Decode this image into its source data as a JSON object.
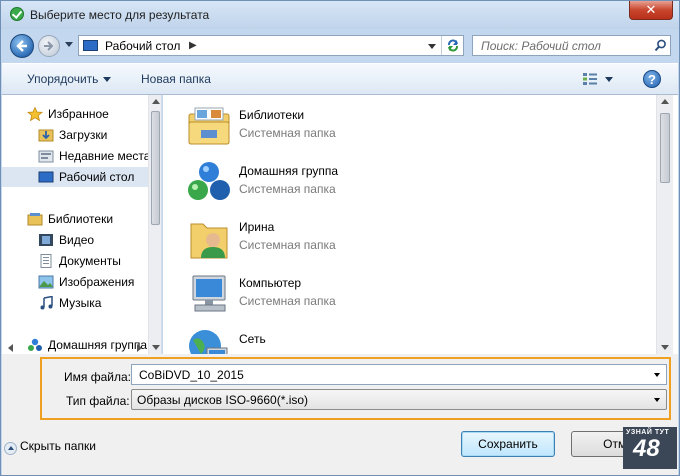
{
  "window": {
    "title": "Выберите место для результата"
  },
  "navbar": {
    "address": "Рабочий стол",
    "search_placeholder": "Поиск: Рабочий стол"
  },
  "toolbar": {
    "organize_label": "Упорядочить",
    "new_folder_label": "Новая папка",
    "help_label": "?"
  },
  "navpane": {
    "items": [
      {
        "label": "Избранное",
        "icon": "star-icon"
      },
      {
        "label": "Загрузки",
        "icon": "downloads-folder-icon"
      },
      {
        "label": "Недавние места",
        "icon": "recent-places-icon"
      },
      {
        "label": "Рабочий стол",
        "icon": "desktop-icon",
        "selected": true
      },
      {
        "label": "Библиотеки",
        "icon": "libraries-icon"
      },
      {
        "label": "Видео",
        "icon": "video-icon"
      },
      {
        "label": "Документы",
        "icon": "documents-icon"
      },
      {
        "label": "Изображения",
        "icon": "pictures-icon"
      },
      {
        "label": "Музыка",
        "icon": "music-icon"
      },
      {
        "label": "Домашняя группа",
        "icon": "homegroup-icon"
      }
    ]
  },
  "files": [
    {
      "name": "Библиотеки",
      "type": "Системная папка",
      "icon": "libraries-folder-icon"
    },
    {
      "name": "Домашняя группа",
      "type": "Системная папка",
      "icon": "homegroup-icon"
    },
    {
      "name": "Ирина",
      "type": "Системная папка",
      "icon": "user-folder-icon"
    },
    {
      "name": "Компьютер",
      "type": "Системная папка",
      "icon": "computer-icon"
    },
    {
      "name": "Сеть",
      "type": "",
      "icon": "network-icon"
    }
  ],
  "form": {
    "filename_label": "Имя файла:",
    "filename_value": "CoBiDVD_10_2015",
    "filetype_label": "Тип файла:",
    "filetype_value": "Образы дисков ISO-9660(*.iso)"
  },
  "footer": {
    "hide_folders_label": "Скрыть папки",
    "save_label": "Сохранить",
    "cancel_label": "Отме"
  },
  "watermark": {
    "top": "УЗНАЙ ТУТ",
    "number": "48"
  },
  "colors": {
    "highlight_border": "#f0a020",
    "accent": "#2d6cc6"
  }
}
